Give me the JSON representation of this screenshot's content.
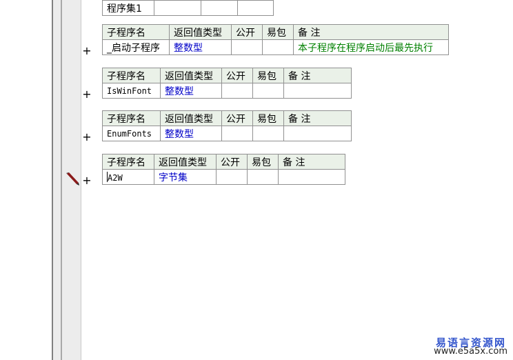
{
  "top_table": {
    "name_cell": "程序集1"
  },
  "columns": {
    "name": "子程序名",
    "return_type": "返回值类型",
    "public": "公开",
    "easy": "易包",
    "remark": "备 注"
  },
  "subroutines": [
    {
      "name": "_启动子程序",
      "return_type": "整数型",
      "remark": "本子程序在程序启动后最先执行"
    },
    {
      "name": "IsWinFont",
      "return_type": "整数型",
      "remark": ""
    },
    {
      "name": "EnumFonts",
      "return_type": "整数型",
      "remark": ""
    },
    {
      "name": "A2W",
      "return_type": "字节集",
      "remark": ""
    }
  ],
  "expand_symbol": "+",
  "watermark": {
    "line1": "易语言资源网",
    "line2": "www.e5a5x.com"
  },
  "colors": {
    "header_bg": "#eaf1e8",
    "type_text": "#0000c8",
    "remark_text": "#008000"
  },
  "icons": {
    "edit_marker": "pencil-icon"
  }
}
